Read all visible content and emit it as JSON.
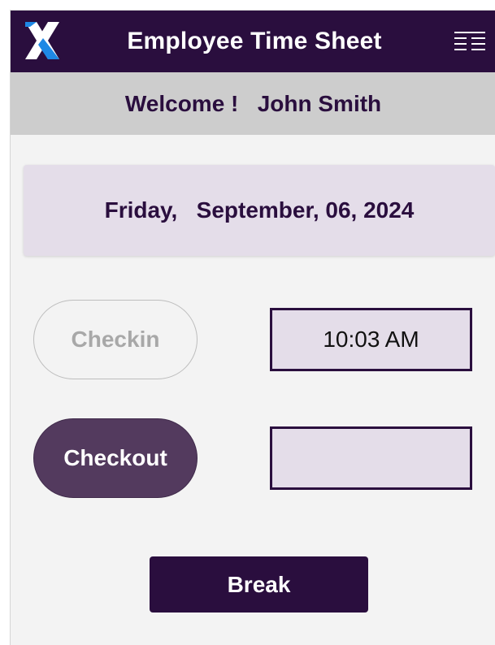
{
  "header": {
    "title": "Employee Time Sheet",
    "logo_icon": "x-logo-icon",
    "menu_icon": "menu-icon"
  },
  "welcome": {
    "text": "Welcome !   John Smith"
  },
  "date": {
    "text": "Friday,   September, 06, 2024"
  },
  "checkin": {
    "button_label": "Checkin",
    "time": "10:03 AM"
  },
  "checkout": {
    "button_label": "Checkout",
    "time": ""
  },
  "break": {
    "button_label": "Break"
  },
  "colors": {
    "header_bg": "#2a0e3e",
    "welcome_bg": "#cdcdcd",
    "card_bg": "#e4dde9",
    "checkout_bg": "#533a5e",
    "logo_blue": "#1e88e5"
  }
}
